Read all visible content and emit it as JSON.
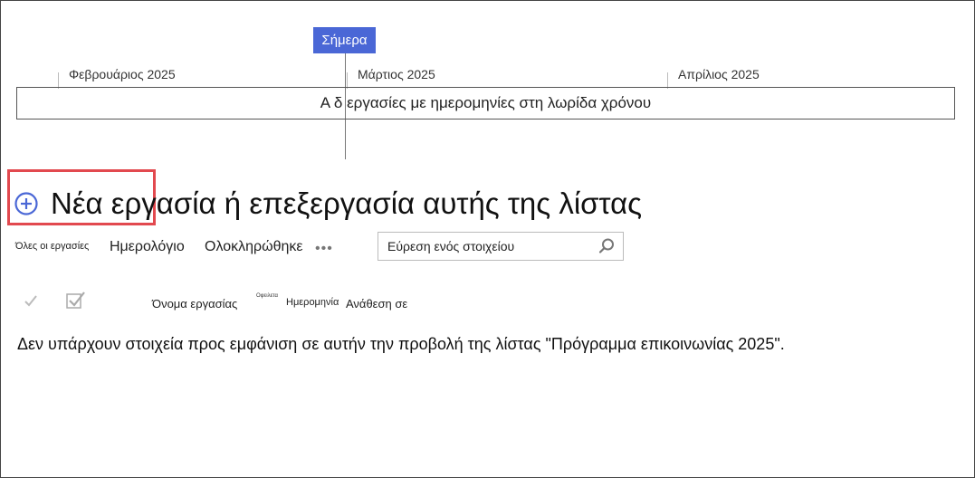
{
  "timeline": {
    "today_label": "Σήμερα",
    "months": [
      "Φεβρουάριος 2025",
      "Μάρτιος 2025",
      "Απρίλιος 2025"
    ],
    "bar_text": "Α δ εργασίες με ημερομηνίες στη λωρίδα χρόνου"
  },
  "header": {
    "title": "Νέα εργασία ή επεξεργασία αυτής της λίστας",
    "add_icon": "plus-circle-icon",
    "highlight_color": "#e2494f"
  },
  "views": {
    "all_tasks": "Όλες οι εργασίες",
    "calendar": "Ημερολόγιο",
    "completed": "Ολοκληρώθηκε",
    "more": "•••"
  },
  "search": {
    "placeholder": "Εύρεση ενός στοιχείου",
    "icon": "search-icon"
  },
  "columns": {
    "task_name": "Όνομα εργασίας",
    "due_prefix": "Οφειλετα",
    "date": "Ημερομηνία",
    "assigned_to": "Ανάθεση σε"
  },
  "empty_message": "Δεν υπάρχουν στοιχεία προς εμφάνιση σε αυτήν την προβολή της λίστας \"Πρόγραμμα επικοινωνίας 2025\".",
  "colors": {
    "accent": "#4a67d6",
    "callout": "#e2494f"
  }
}
